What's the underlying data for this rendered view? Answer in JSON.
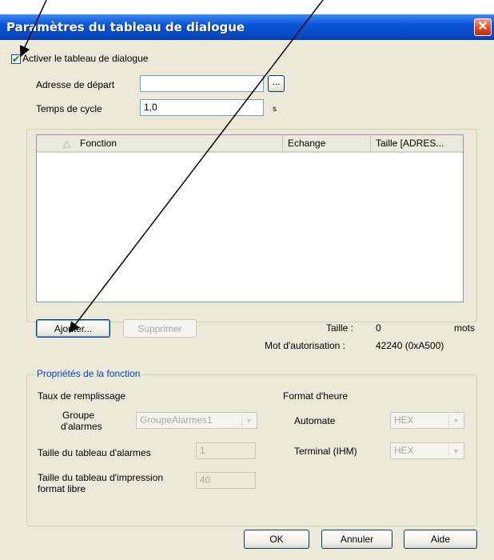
{
  "dialog": {
    "title": "Paramètres du tableau de dialogue",
    "close_glyph": "✕"
  },
  "activate": {
    "label": "Activer le tableau de dialogue",
    "checked": true
  },
  "start_address": {
    "label": "Adresse de départ",
    "value": "",
    "browse_label": "..."
  },
  "cycle_time": {
    "label": "Temps de cycle",
    "value": "1,0",
    "unit": "s"
  },
  "table": {
    "columns": [
      "Fonction",
      "Echange",
      "Taille [ADRES..."
    ],
    "sort_glyph": "△",
    "rows": []
  },
  "actions": {
    "add_label": "Ajouter...",
    "delete_label": "Supprimer"
  },
  "summary": {
    "size_label": "Taille :",
    "size_value": "0",
    "size_unit": "mots",
    "auth_label": "Mot d'autorisation :",
    "auth_value": "42240 (0xA500)"
  },
  "properties": {
    "legend": "Propriétés de la fonction",
    "fill_rate_label": "Taux de remplissage",
    "alarm_group_label_1": "Groupe",
    "alarm_group_label_2": "d'alarmes",
    "alarm_group_value": "GroupeAlarmes1",
    "alarm_table_size_label": "Taille du tableau d'alarmes",
    "alarm_table_size_value": "1",
    "print_table_label_1": "Taille du tableau d'impression",
    "print_table_label_2": "format libre",
    "print_table_value": "40",
    "time_format_label": "Format d'heure",
    "plc_label": "Automate",
    "plc_value": "HEX",
    "terminal_label": "Terminal (IHM)",
    "terminal_value": "HEX"
  },
  "footer": {
    "ok_label": "OK",
    "cancel_label": "Annuler",
    "help_label": "Aide"
  },
  "colors": {
    "titlebar": "#0a55d8",
    "dialog_bg": "#ece9d8",
    "group_legend": "#0046d5",
    "check_mark": "#21a121"
  }
}
